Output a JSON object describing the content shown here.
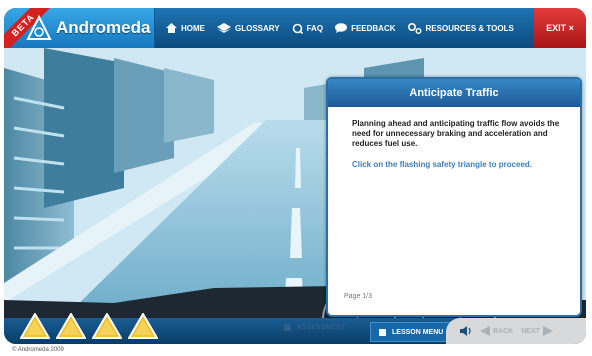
{
  "app": {
    "title": "Andromeda",
    "beta_label": "BETA"
  },
  "nav": {
    "items": [
      {
        "label": "HOME",
        "icon": "home-icon"
      },
      {
        "label": "GLOSSARY",
        "icon": "book-icon"
      },
      {
        "label": "FAQ",
        "icon": "faq-icon"
      },
      {
        "label": "FEEDBACK",
        "icon": "speech-bubble-icon"
      },
      {
        "label": "RESOURCES & TOOLS",
        "icon": "gears-icon"
      }
    ],
    "exit_label": "EXIT ×"
  },
  "panel": {
    "title": "Anticipate Traffic",
    "text": "Planning ahead and anticipating traffic flow avoids the need for unnecessary braking and acceleration and reduces fuel use.",
    "instruction": "Click on the flashing safety triangle to proceed.",
    "page": "Page 1/3"
  },
  "footer": {
    "assessment_label": "ASSESSMENT",
    "lesson_menu_label": "LESSON MENU",
    "back_label": "BACK",
    "next_label": "NEXT",
    "copyright": "© Andromeda 2009"
  },
  "colors": {
    "accent": "#1f74b3",
    "exit": "#d62828",
    "triangle": "#f2c230"
  }
}
